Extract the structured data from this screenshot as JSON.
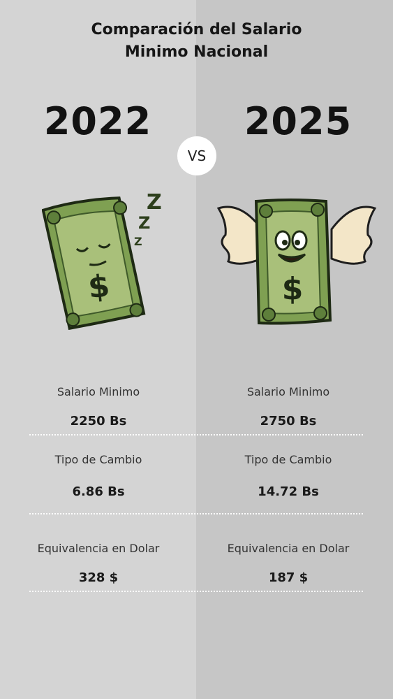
{
  "title": {
    "line1": "Comparación del Salario",
    "line2": "Minimo Nacional"
  },
  "vs_label": "VS",
  "columns": [
    {
      "year": "2022",
      "illustration": "sleeping-dollar-bill",
      "rows": [
        {
          "label": "Salario Minimo",
          "value": "2250 Bs"
        },
        {
          "label": "Tipo de Cambio",
          "value": "6.86 Bs"
        },
        {
          "label": "Equivalencia en Dolar",
          "value": "328 $"
        }
      ]
    },
    {
      "year": "2025",
      "illustration": "winged-dollar-bill",
      "rows": [
        {
          "label": "Salario Minimo",
          "value": "2750 Bs"
        },
        {
          "label": "Tipo de Cambio",
          "value": "14.72 Bs"
        },
        {
          "label": "Equivalencia en Dolar",
          "value": "187 $"
        }
      ]
    }
  ],
  "colors": {
    "background_left": "#d4d4d4",
    "background_right": "#c6c6c6",
    "bill_green": "#7fa052",
    "bill_dark": "#3f5a2a",
    "wing": "#f3e6c8"
  }
}
